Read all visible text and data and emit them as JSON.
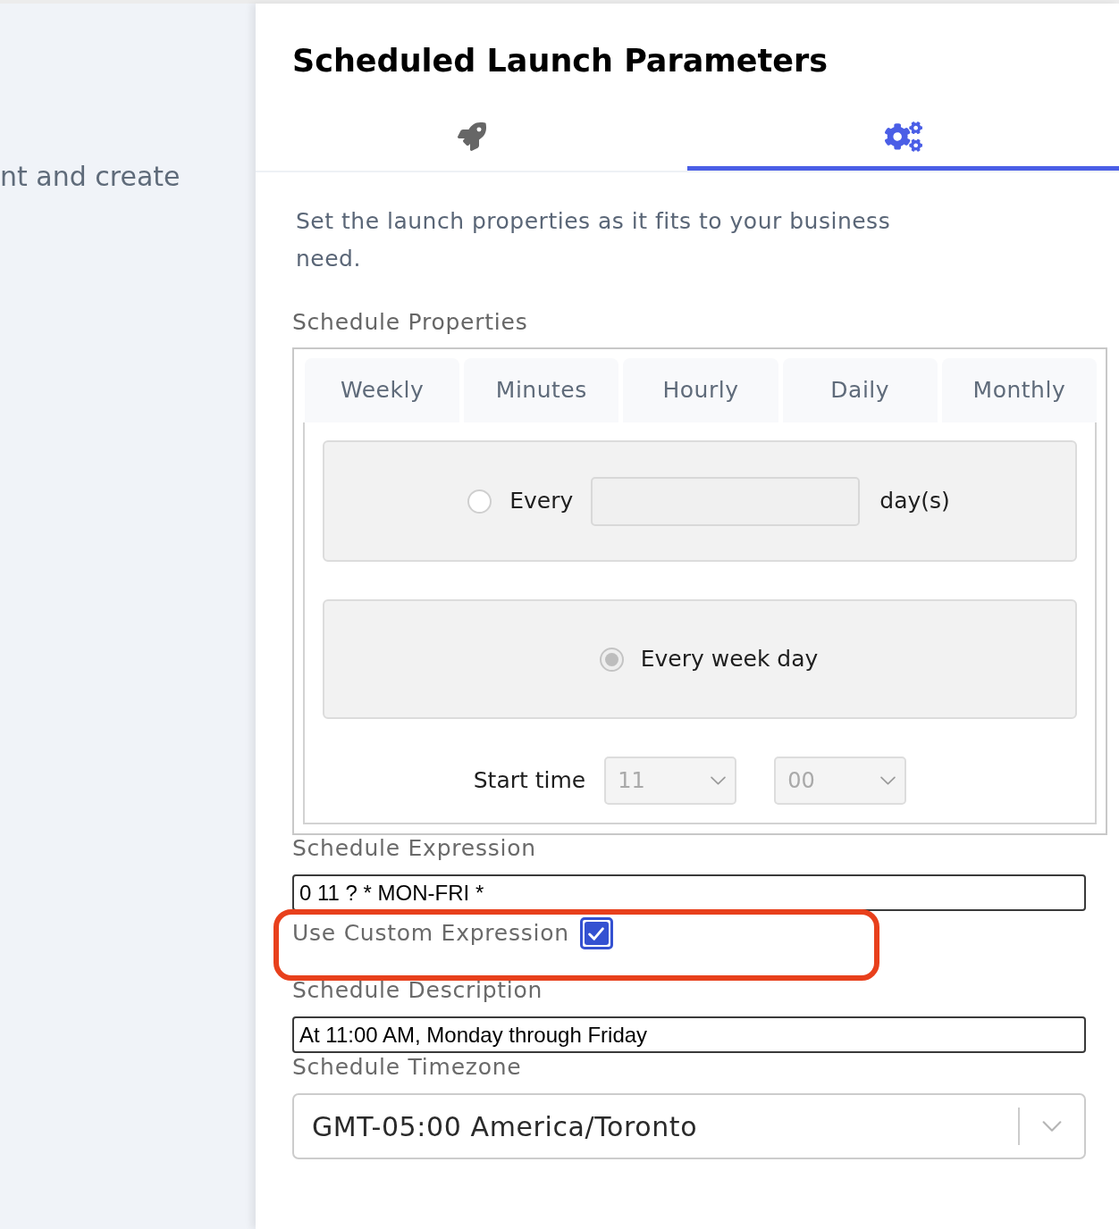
{
  "background_panel": {
    "text": "nt and create"
  },
  "panel": {
    "title": "Scheduled Launch Parameters"
  },
  "icon_tabs": [
    {
      "kind": "rocket",
      "selected": false
    },
    {
      "kind": "gears",
      "selected": true
    }
  ],
  "intro": "Set the launch properties as it fits to your business need.",
  "schedule_properties": {
    "label": "Schedule Properties",
    "tabs": [
      {
        "label": "Weekly"
      },
      {
        "label": "Minutes"
      },
      {
        "label": "Hourly"
      },
      {
        "label": "Daily"
      },
      {
        "label": "Monthly"
      }
    ],
    "options": [
      {
        "kind": "every_n_days",
        "selected": false,
        "prefix": "Every",
        "suffix": "day(s)"
      },
      {
        "kind": "week_days",
        "selected": true,
        "label": "Every week day"
      }
    ],
    "start_time": {
      "label": "Start time",
      "hour": "11",
      "minute": "00",
      "disabled": true
    }
  },
  "schedule_expression": {
    "label": "Schedule Expression",
    "value": "0 11 ? * MON-FRI *"
  },
  "use_custom_expression": {
    "label": "Use Custom Expression",
    "checked": true,
    "highlighted": true
  },
  "schedule_description": {
    "label": "Schedule Description",
    "value": "At 11:00 AM, Monday through Friday"
  },
  "schedule_timezone": {
    "label": "Schedule Timezone",
    "value": "GMT-05:00 America/Toronto"
  }
}
